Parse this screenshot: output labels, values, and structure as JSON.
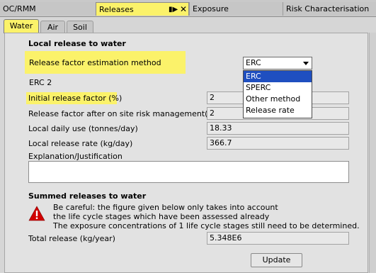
{
  "top_tabs": [
    {
      "label": "OC/RMM"
    },
    {
      "label": "Releases"
    },
    {
      "label": "Exposure"
    },
    {
      "label": "Risk Characterisation"
    }
  ],
  "sub_tabs": [
    "Water",
    "Air",
    "Soil"
  ],
  "local": {
    "title": "Local release to water",
    "method_label": "Release factor estimation method",
    "method_value": "ERC",
    "method_options": [
      "ERC",
      "SPERC",
      "Other method",
      "Release rate"
    ],
    "erc_value": "ERC 2",
    "initial_label": "Initial release factor (%)",
    "initial_value": "2",
    "after_label": "Release factor after on site risk management(%)",
    "after_value": "2",
    "daily_use_label": "Local daily use (tonnes/day)",
    "daily_use_value": "18.33",
    "release_rate_label": "Local release rate (kg/day)",
    "release_rate_value": "366.7",
    "explanation_label": "Explanation/Justification",
    "explanation_value": ""
  },
  "summed": {
    "title": "Summed releases to water",
    "warning_line1": "Be careful: the figure given below only takes into account",
    "warning_line2": "the life cycle stages which have been assessed already",
    "warning_line3": "The exposure concentrations of 1 life cycle stages still need to be determined.",
    "total_label": "Total release (kg/year)",
    "total_value": "5.348E6",
    "update_label": "Update"
  },
  "colors": {
    "highlight": "#fbf26a",
    "selection": "#1f4fc0",
    "warning": "#d10000"
  }
}
